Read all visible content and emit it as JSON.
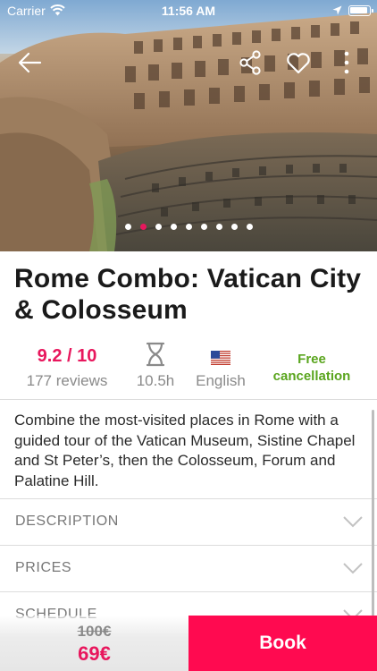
{
  "status_bar": {
    "carrier": "Carrier",
    "time": "11:56 AM"
  },
  "hero": {
    "image_description_icon": "colosseum-photo",
    "slide_count": 9,
    "active_slide": 2,
    "accent_color": "#e8175d"
  },
  "tour": {
    "title": "Rome Combo: Vatican City & Colosseum",
    "rating": "9.2 / 10",
    "reviews": "177 reviews",
    "duration": "10.5h",
    "language": "English",
    "cancellation": "Free cancellation",
    "summary": "Combine the most-visited places in Rome with a guided tour of the Vatican Museum, Sistine Chapel and St Peter’s, then the Colosseum, Forum and Palatine Hill."
  },
  "sections": [
    {
      "label": "DESCRIPTION"
    },
    {
      "label": "PRICES"
    },
    {
      "label": "SCHEDULE"
    }
  ],
  "booking": {
    "old_price": "100€",
    "new_price": "69€",
    "book_label": "Book",
    "book_color": "#ff0a50"
  }
}
